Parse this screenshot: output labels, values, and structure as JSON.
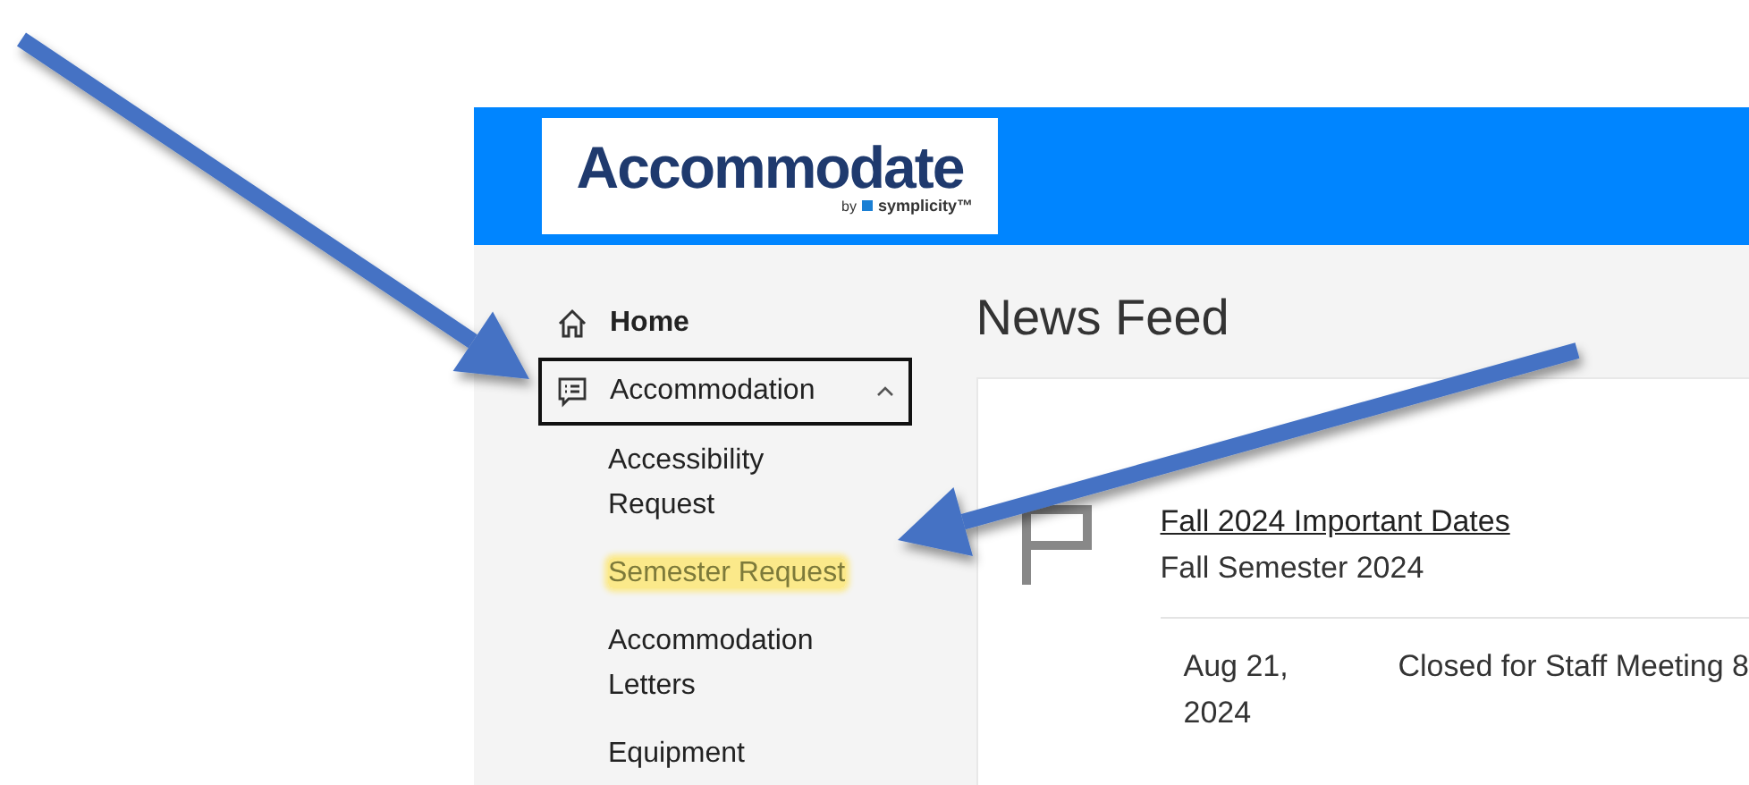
{
  "header": {
    "logo": {
      "name": "Accommodate",
      "byline": "by",
      "brand": "symplicity™"
    }
  },
  "sidebar": {
    "items": [
      {
        "label": "Home",
        "kind": "home",
        "selected": false
      },
      {
        "label": "Accommodation",
        "kind": "group",
        "selected": true,
        "expanded": true,
        "children": [
          {
            "label": "Accessibility Request",
            "highlighted": false
          },
          {
            "label": "Semester Request",
            "highlighted": true
          },
          {
            "label": "Accommodation Letters",
            "highlighted": false
          },
          {
            "label": "Equipment",
            "highlighted": false
          }
        ]
      }
    ]
  },
  "main": {
    "title": "News Feed",
    "news": [
      {
        "title": "Fall 2024 Important Dates",
        "subtitle": "Fall Semester 2024",
        "rows": [
          {
            "date": "Aug 21, 2024",
            "text": "Closed for Staff Meeting 8"
          }
        ]
      }
    ]
  }
}
